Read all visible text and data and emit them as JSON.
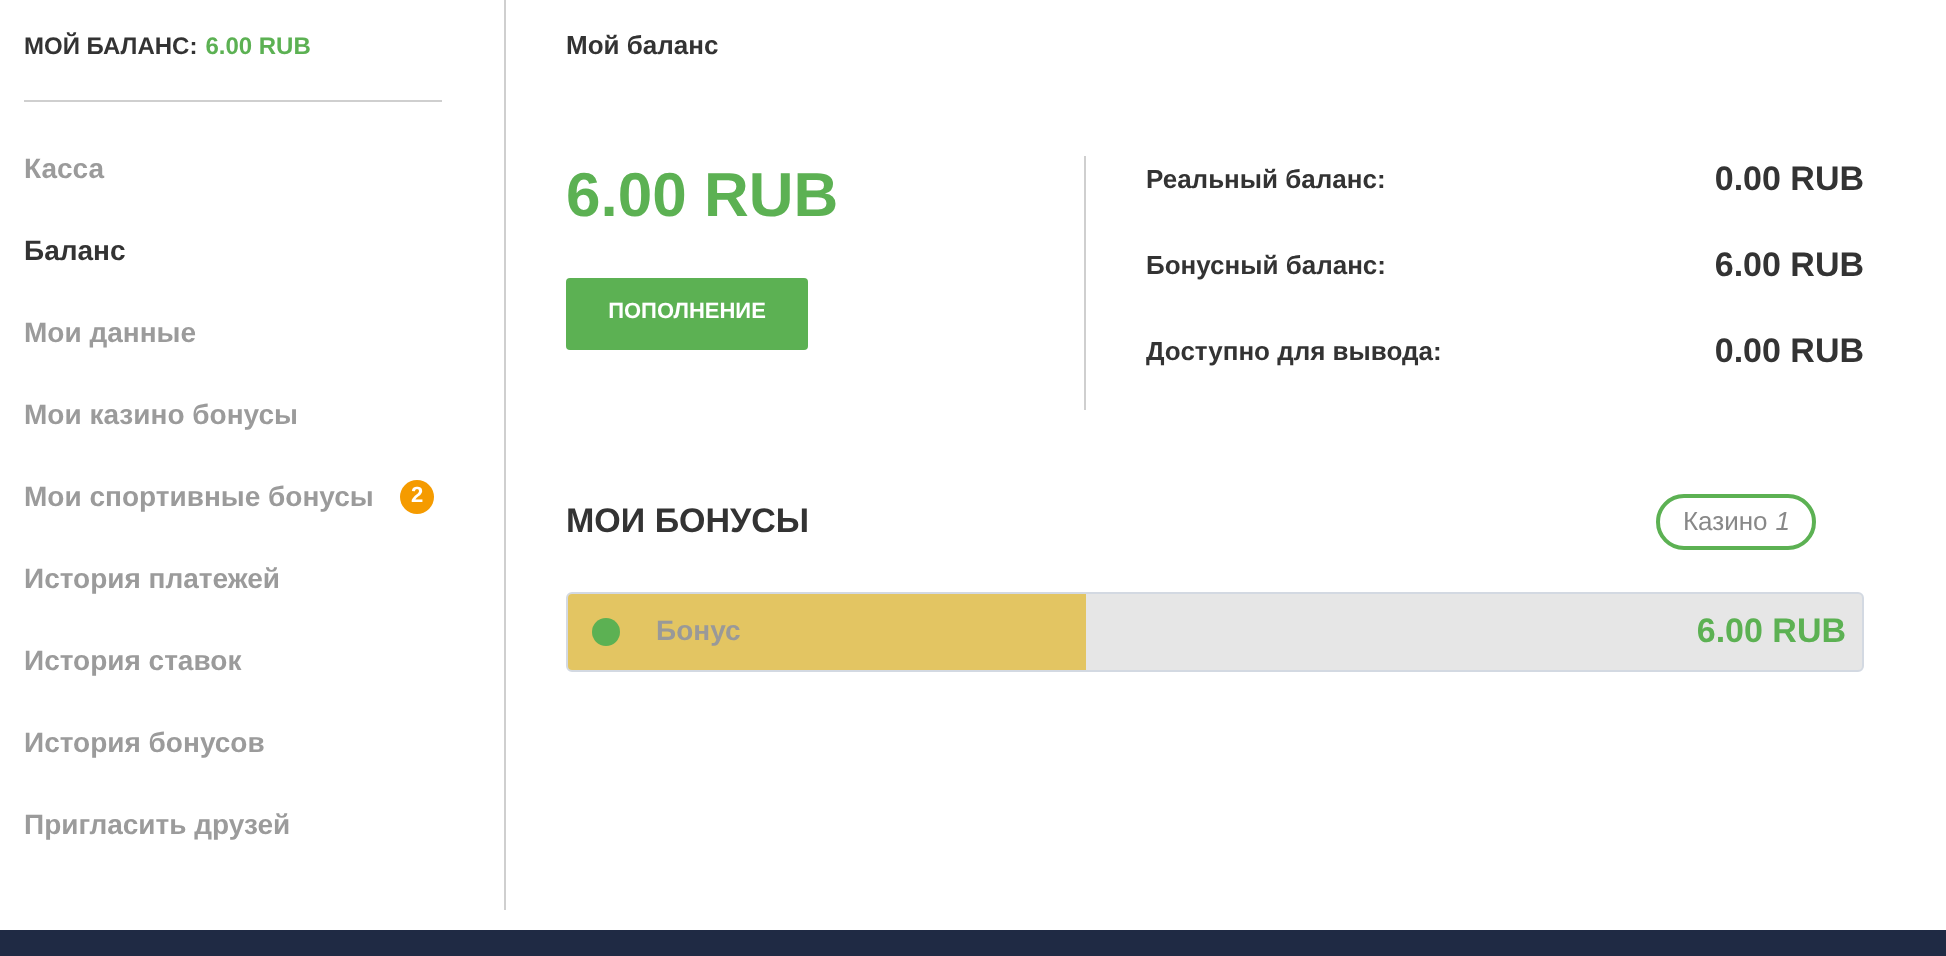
{
  "sidebar": {
    "balance_label": "МОЙ БАЛАНС:",
    "balance_value": "6.00 RUB",
    "items": [
      {
        "label": "Касса",
        "selected": false
      },
      {
        "label": "Баланс",
        "selected": true
      },
      {
        "label": "Мои данные",
        "selected": false
      },
      {
        "label": "Мои казино бонусы",
        "selected": false
      },
      {
        "label": "Мои спортивные бонусы",
        "selected": false,
        "badge": "2"
      },
      {
        "label": "История платежей",
        "selected": false
      },
      {
        "label": "История ставок",
        "selected": false
      },
      {
        "label": "История бонусов",
        "selected": false
      },
      {
        "label": "Пригласить друзей",
        "selected": false
      }
    ]
  },
  "main": {
    "title": "Мой баланс",
    "total": "6.00 RUB",
    "deposit_button": "ПОПОЛНЕНИЕ",
    "balances": [
      {
        "label": "Реальный баланс:",
        "value": "0.00 RUB"
      },
      {
        "label": "Бонусный баланс:",
        "value": "6.00 RUB"
      },
      {
        "label": "Доступно для вывода:",
        "value": "0.00 RUB"
      }
    ],
    "bonuses": {
      "title": "МОИ БОНУСЫ",
      "filter": {
        "label": "Казино",
        "count": "1"
      },
      "items": [
        {
          "name": "Бонус",
          "amount": "6.00 RUB",
          "color": "#5cb153",
          "level": 0.4
        }
      ]
    }
  }
}
